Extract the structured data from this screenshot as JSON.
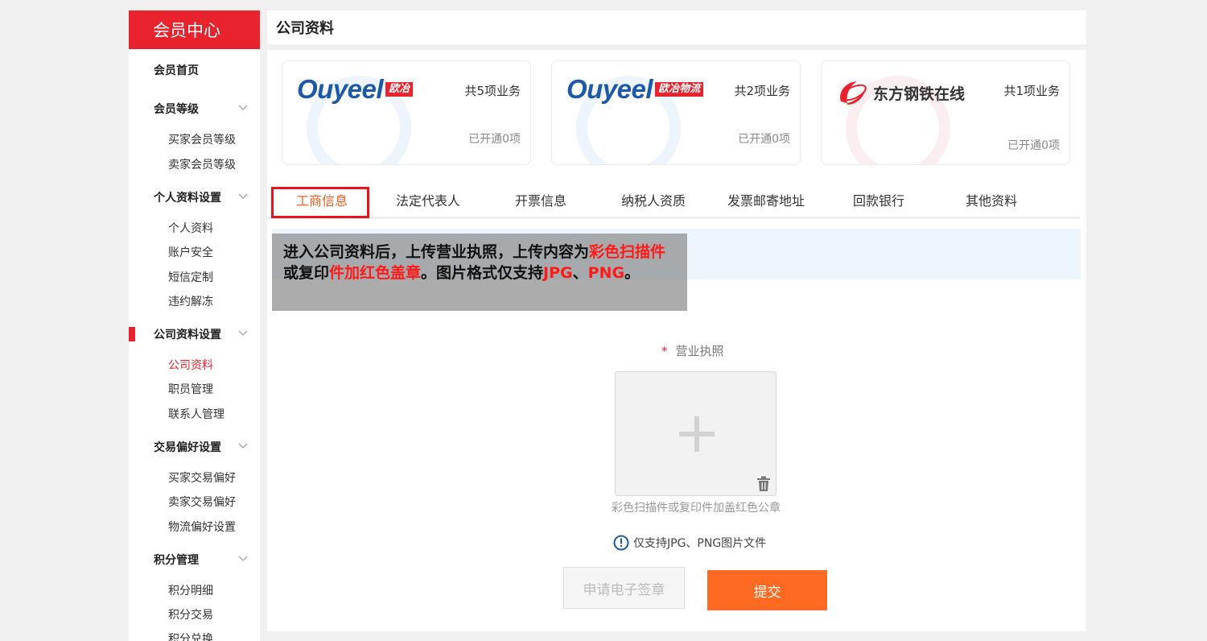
{
  "sidebar": {
    "title": "会员中心",
    "home": "会员首页",
    "groups": [
      {
        "label": "会员等级",
        "items": [
          "买家会员等级",
          "卖家会员等级"
        ]
      },
      {
        "label": "个人资料设置",
        "items": [
          "个人资料",
          "账户安全",
          "短信定制",
          "违约解冻"
        ]
      },
      {
        "label": "公司资料设置",
        "items": [
          "公司资料",
          "职员管理",
          "联系人管理"
        ]
      },
      {
        "label": "交易偏好设置",
        "items": [
          "买家交易偏好",
          "卖家交易偏好",
          "物流偏好设置"
        ]
      },
      {
        "label": "积分管理",
        "items": [
          "积分明细",
          "积分交易",
          "积分兑换"
        ]
      }
    ],
    "active_item": "公司资料"
  },
  "page_title": "公司资料",
  "cards": [
    {
      "logo": "Ouyeel",
      "tag": "欧冶",
      "count": "共5项业务",
      "opened": "已开通0项"
    },
    {
      "logo": "Ouyeel",
      "tag": "欧冶物流",
      "count": "共2项业务",
      "opened": "已开通0项"
    },
    {
      "logo": "东方钢铁在线",
      "tag": "",
      "count": "共1项业务",
      "opened": "已开通0项"
    }
  ],
  "tabs": [
    "工商信息",
    "法定代表人",
    "开票信息",
    "纳税人资质",
    "发票邮寄地址",
    "回款银行",
    "其他资料"
  ],
  "active_tab": "工商信息",
  "tooltip": {
    "t1": "进入公司资料后，上传营业执照，上传内容为",
    "r1": "彩色扫描件",
    "t2": "或复印",
    "r2": "件加红色盖章",
    "t3": "。图片格式仅支持",
    "r3": "JPG",
    "t4": "、",
    "r4": "PNG",
    "t5": "。"
  },
  "form": {
    "required_mark": "*",
    "license_label": "营业执照",
    "upload_hint": "彩色扫描件或复印件加盖红色公章",
    "support_note": "仅支持JPG、PNG图片文件"
  },
  "buttons": {
    "sign": "申请电子签章",
    "submit": "提交"
  },
  "colors": {
    "brand_red": "#e8232d",
    "accent_orange": "#ff6a23",
    "ouyeel_blue": "#1c5aa8"
  }
}
